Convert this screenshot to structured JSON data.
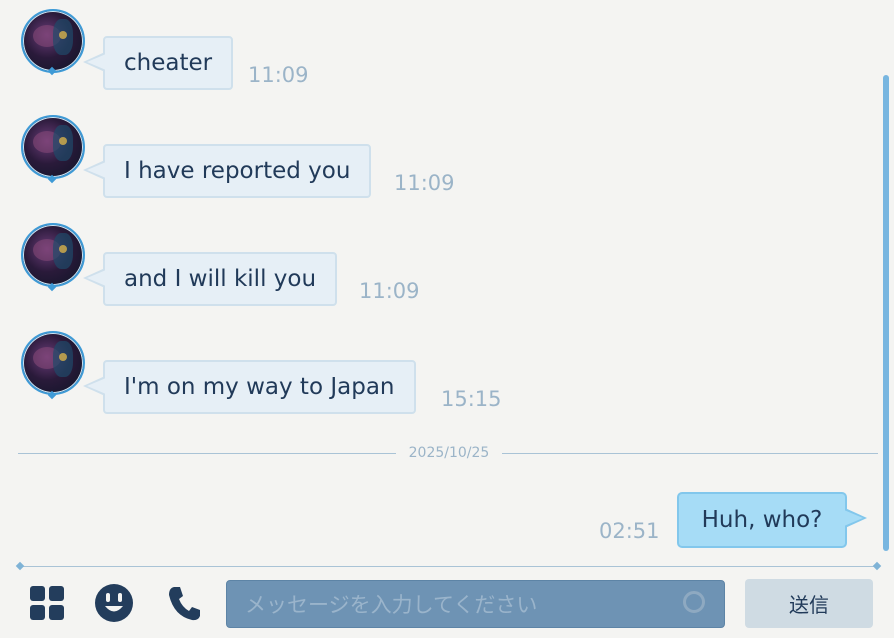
{
  "messages": [
    {
      "text": "cheater",
      "time": "11:09",
      "from": "other"
    },
    {
      "text": "I have reported you",
      "time": "11:09",
      "from": "other"
    },
    {
      "text": "and I will kill you",
      "time": "11:09",
      "from": "other"
    },
    {
      "text": "I'm on my way to Japan",
      "time": "15:15",
      "from": "other"
    }
  ],
  "date_separator": "2025/10/25",
  "my_message": {
    "text": "Huh, who?",
    "time": "02:51",
    "from": "me"
  },
  "composer": {
    "placeholder": "メッセージを入力してください",
    "send_label": "送信"
  },
  "icons": {
    "menu": "grid-icon",
    "emoji": "stamp-face-icon",
    "call": "phone-icon",
    "input_action": "ring-icon"
  },
  "colors": {
    "background": "#f4f4f2",
    "incoming_bubble": "#e6eff6",
    "outgoing_bubble": "#a6dcf6",
    "text": "#213a59",
    "timestamp": "#9bb4c8",
    "input": "#6e93b4",
    "send_button": "#cfdbe3",
    "accent": "#3e9ad6"
  }
}
